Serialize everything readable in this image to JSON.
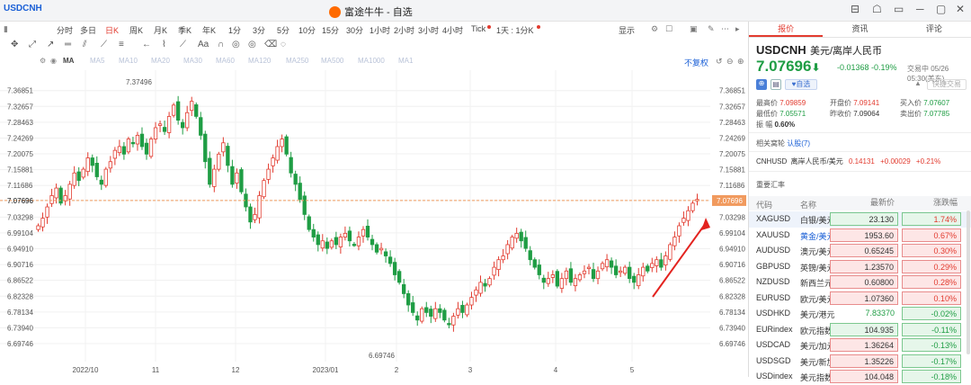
{
  "window": {
    "tab_label": "USDCNH",
    "title": "富途牛牛 - 自选",
    "controls": [
      "⊟",
      "☖",
      "▭",
      "─",
      "▢",
      "✕"
    ]
  },
  "toolbar": {
    "periods": [
      "分时",
      "多日",
      "日K",
      "周K",
      "月K",
      "季K",
      "年K",
      "1分",
      "3分",
      "5分",
      "10分",
      "15分",
      "30分",
      "1小时",
      "2小时",
      "3小时",
      "4小时",
      "Tick",
      "1天 : 1分K"
    ],
    "active_period": "日K",
    "display_label": "显示"
  },
  "indicators": {
    "ma_label": "MA",
    "items": [
      "MA5",
      "MA10",
      "MA20",
      "MA30",
      "MA60",
      "MA120",
      "MA250",
      "MA500",
      "MA1000",
      "MA1"
    ],
    "adjust_label": "不复权"
  },
  "chart_data": {
    "type": "candlestick",
    "y_ticks": [
      "7.36851",
      "7.32657",
      "7.28463",
      "7.24269",
      "7.20075",
      "7.15881",
      "7.11686",
      "7.07696",
      "7.03298",
      "6.99104",
      "6.94910",
      "6.90716",
      "6.86522",
      "6.82328",
      "6.78134",
      "6.73940",
      "6.69746"
    ],
    "x_ticks": [
      "2022/10",
      "11",
      "12",
      "2023/01",
      "2",
      "3",
      "4",
      "5"
    ],
    "high_label": "7.37496",
    "low_label": "6.69746",
    "current_price": "7.07696",
    "ylim": [
      6.69746,
      7.37496
    ],
    "closes": [
      7.01,
      7.03,
      7.06,
      7.09,
      7.11,
      7.07,
      7.09,
      7.12,
      7.15,
      7.13,
      7.16,
      7.19,
      7.17,
      7.14,
      7.12,
      7.16,
      7.18,
      7.21,
      7.22,
      7.2,
      7.24,
      7.23,
      7.25,
      7.22,
      7.2,
      7.24,
      7.27,
      7.28,
      7.26,
      7.3,
      7.33,
      7.29,
      7.27,
      7.31,
      7.34,
      7.3,
      7.25,
      7.18,
      7.12,
      7.16,
      7.2,
      7.23,
      7.17,
      7.12,
      7.15,
      7.1,
      7.06,
      7.02,
      7.04,
      7.09,
      7.13,
      7.16,
      7.19,
      7.22,
      7.24,
      7.2,
      7.15,
      7.12,
      7.08,
      7.04,
      7.0,
      6.98,
      6.96,
      6.97,
      6.95,
      6.97,
      6.96,
      6.98,
      6.99,
      6.97,
      6.96,
      6.98,
      7.0,
      6.98,
      6.96,
      6.94,
      6.95,
      6.93,
      6.91,
      6.88,
      6.86,
      6.83,
      6.8,
      6.78,
      6.76,
      6.79,
      6.78,
      6.77,
      6.79,
      6.78,
      6.76,
      6.75,
      6.77,
      6.79,
      6.78,
      6.8,
      6.82,
      6.84,
      6.86,
      6.85,
      6.87,
      6.9,
      6.92,
      6.93,
      6.96,
      6.98,
      6.99,
      6.97,
      6.95,
      6.92,
      6.9,
      6.88,
      6.86,
      6.87,
      6.88,
      6.85,
      6.87,
      6.89,
      6.86,
      6.87,
      6.88,
      6.89,
      6.9,
      6.87,
      6.89,
      6.91,
      6.92,
      6.9,
      6.88,
      6.89,
      6.9,
      6.87,
      6.86,
      6.88,
      6.9,
      6.89,
      6.91,
      6.92,
      6.9,
      6.93,
      6.96,
      6.98,
      7.01,
      7.03,
      7.05,
      7.07,
      7.08
    ],
    "annotation": "red arrow pointing to latest candles"
  },
  "quote": {
    "tabs": [
      "报价",
      "资讯",
      "评论"
    ],
    "active_tab": "报价",
    "symbol": "USDCNH",
    "name": "美元/离岸人民币",
    "price": "7.07696",
    "arrow": "⬇",
    "change": "-0.01368",
    "change_pct": "-0.19%",
    "status": "交易中 05/26 05:30(美东)",
    "watch_label": "自选",
    "quick_trade": "快捷交易",
    "fields": {
      "high_label": "最高价",
      "high": "7.09859",
      "open_label": "开盘价",
      "open": "7.09141",
      "bid_label": "买入价",
      "bid": "7.07607",
      "low_label": "最低价",
      "low": "7.05571",
      "prev_label": "昨收价",
      "prev": "7.09064",
      "ask_label": "卖出价",
      "ask": "7.07785",
      "amp_label": "振 幅",
      "amp": "0.60%"
    },
    "related_label": "相关窝轮",
    "related_link": "认股(7)",
    "cnh_row": {
      "code": "CNHUSD",
      "name": "离岸人民币/美元",
      "price": "0.14131",
      "chg": "+0.00029",
      "pct": "+0.21%"
    },
    "fx_section": "重要汇率"
  },
  "fx_table": {
    "headers": [
      "代码",
      "名称",
      "最新价",
      "涨跌幅"
    ],
    "rows": [
      {
        "code": "XAGUSD",
        "name": "白银/美元",
        "price": "23.130",
        "pct": "1.74%",
        "dir": "up-g"
      },
      {
        "code": "XAUUSD",
        "name": "黄金/美元",
        "price": "1953.60",
        "pct": "0.67%",
        "dir": "up"
      },
      {
        "code": "AUDUSD",
        "name": "澳元/美元",
        "price": "0.65245",
        "pct": "0.30%",
        "dir": "up"
      },
      {
        "code": "GBPUSD",
        "name": "英镑/美元",
        "price": "1.23570",
        "pct": "0.29%",
        "dir": "up"
      },
      {
        "code": "NZDUSD",
        "name": "新西兰元/美元",
        "price": "0.60800",
        "pct": "0.28%",
        "dir": "up"
      },
      {
        "code": "EURUSD",
        "name": "欧元/美元",
        "price": "1.07360",
        "pct": "0.10%",
        "dir": "up"
      },
      {
        "code": "USDHKD",
        "name": "美元/港元",
        "price": "7.83370",
        "pct": "-0.02%",
        "dir": "dn"
      },
      {
        "code": "EURindex",
        "name": "欧元指数",
        "price": "104.935",
        "pct": "-0.11%",
        "dir": "dn"
      },
      {
        "code": "USDCAD",
        "name": "美元/加元",
        "price": "1.36264",
        "pct": "-0.13%",
        "dir": "dn"
      },
      {
        "code": "USDSGD",
        "name": "美元/新加坡元",
        "price": "1.35226",
        "pct": "-0.17%",
        "dir": "dn"
      },
      {
        "code": "USDindex",
        "name": "美元指数",
        "price": "104.048",
        "pct": "-0.18%",
        "dir": "dn"
      }
    ]
  }
}
